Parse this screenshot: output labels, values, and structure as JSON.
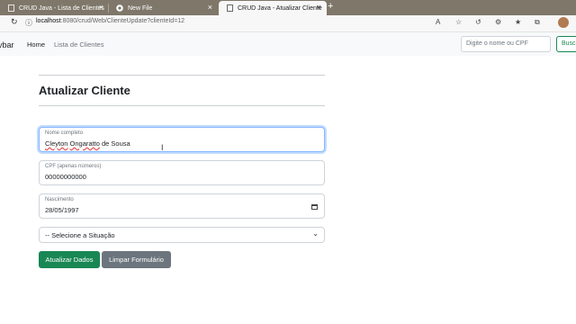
{
  "browser": {
    "tabs": [
      {
        "title": "CRUD Java - Lista de Clientes",
        "close": "×"
      },
      {
        "title": "New File",
        "close": "×"
      },
      {
        "title": "CRUD Java - Atualizar Cliente",
        "close": "×"
      }
    ],
    "new_tab": "+",
    "url_host": "localhost",
    "url_rest": ":8080/crud/Web/ClienteUpdate?clienteId=12"
  },
  "navbar": {
    "brand": "vbar",
    "links": [
      "Home",
      "Lista de Clientes"
    ],
    "search_placeholder": "Digite o nome ou CPF",
    "search_button": "Busc"
  },
  "form": {
    "title": "Atualizar Cliente",
    "nome": {
      "label": "Nome completo",
      "value_a": "Cleyton",
      "value_b": "Ongaratto",
      "value_c": "de Sousa"
    },
    "cpf": {
      "label": "CPF (apenas números)",
      "value": "00000000000"
    },
    "nascimento": {
      "label": "Nascimento",
      "value": "28/05/1997"
    },
    "situacao": {
      "selected": "-- Selecione a Situação"
    },
    "buttons": {
      "submit": "Atualizar Dados",
      "reset": "Limpar Formulário"
    }
  },
  "colors": {
    "success": "#198754",
    "secondary": "#6c757d",
    "accent": "#86b7fe"
  }
}
